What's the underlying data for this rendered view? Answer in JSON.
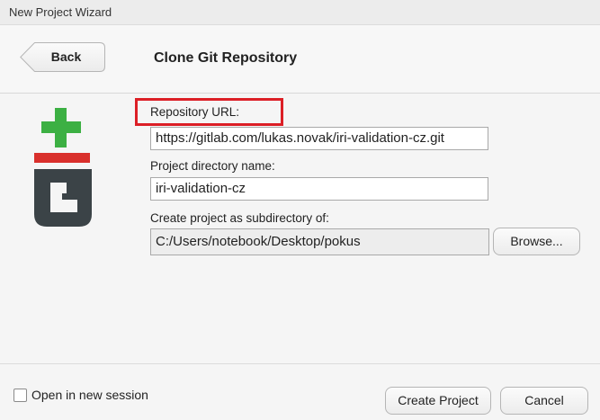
{
  "window": {
    "title": "New Project Wizard"
  },
  "header": {
    "back_label": "Back",
    "title": "Clone Git Repository"
  },
  "logo": {
    "icon": "git-logo"
  },
  "form": {
    "repo_url_label": "Repository URL:",
    "repo_url_value": "https://gitlab.com/lukas.novak/iri-validation-cz.git",
    "dir_name_label": "Project directory name:",
    "dir_name_value": "iri-validation-cz",
    "subdir_label": "Create project as subdirectory of:",
    "subdir_value": "C:/Users/notebook/Desktop/pokus",
    "browse_label": "Browse..."
  },
  "footer": {
    "new_session_label": "Open in new session",
    "new_session_checked": false,
    "create_label": "Create Project",
    "cancel_label": "Cancel"
  },
  "colors": {
    "highlight": "#dc1f26",
    "git_green": "#3cb043",
    "git_red": "#d9302c",
    "git_gray": "#3b4347"
  }
}
